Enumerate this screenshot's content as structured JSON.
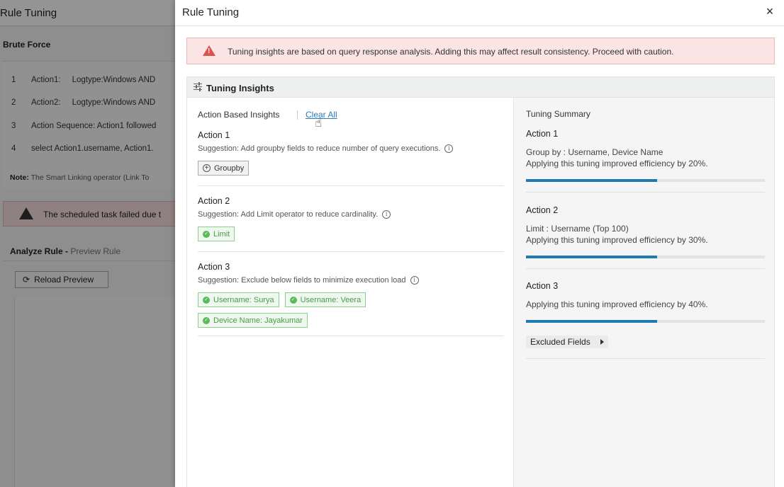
{
  "background": {
    "title": "Rule Tuning",
    "section": "Brute Force",
    "rules": [
      {
        "num": "1",
        "label": "Action1:",
        "text": "Logtype:Windows AND"
      },
      {
        "num": "2",
        "label": "Action2:",
        "text": "Logtype:Windows AND"
      },
      {
        "num": "3",
        "label": "",
        "text": "Action Sequence: Action1 followed"
      },
      {
        "num": "4",
        "label": "",
        "text": "select Action1.username, Action1."
      }
    ],
    "note_label": "Note:",
    "note_text": "The Smart Linking operator (Link To",
    "alert_text": "The scheduled task failed due t",
    "analyze_label": "Analyze Rule -",
    "analyze_sub": "Preview Rule",
    "reload_label": "Reload Preview"
  },
  "modal": {
    "title": "Rule Tuning",
    "close": "×",
    "warning": "Tuning insights are based on query response analysis. Adding this may affect result consistency. Proceed with caution.",
    "panel_title": "Tuning Insights"
  },
  "insights": {
    "heading": "Action Based Insights",
    "clear_all": "Clear All",
    "actions": [
      {
        "title": "Action 1",
        "suggestion": "Suggestion: Add groupby fields to reduce number of query executions.",
        "tags": [
          {
            "label": "Groupby",
            "style": "add"
          }
        ]
      },
      {
        "title": "Action 2",
        "suggestion": "Suggestion: Add Limit operator to reduce cardinality.",
        "tags": [
          {
            "label": "Limit",
            "style": "applied"
          }
        ]
      },
      {
        "title": "Action 3",
        "suggestion": "Suggestion: Exclude below fields to minimize execution load",
        "tags": [
          {
            "label": "Username: Surya",
            "style": "applied"
          },
          {
            "label": "Username: Veera",
            "style": "applied"
          },
          {
            "label": "Device Name: Jayakumar",
            "style": "applied"
          }
        ]
      }
    ]
  },
  "summary": {
    "heading": "Tuning Summary",
    "items": [
      {
        "title": "Action 1",
        "lines": [
          "Group by : Username, Device Name",
          "Applying this tuning improved efficiency by 20%."
        ],
        "progress": 0.55
      },
      {
        "title": "Action 2",
        "lines": [
          "Limit : Username (Top 100)",
          "Applying this tuning improved efficiency by 30%."
        ],
        "progress": 0.55
      },
      {
        "title": "Action 3",
        "lines": [
          "Applying this tuning improved efficiency by 40%."
        ],
        "progress": 0.55,
        "button": "Excluded Fields"
      }
    ]
  },
  "colors": {
    "accent": "#1f7ab3",
    "link": "#2b7bb9",
    "warning_bg": "#fbe4e4",
    "warning_icon": "#d9534f",
    "tag_green": "#5cb85c"
  }
}
